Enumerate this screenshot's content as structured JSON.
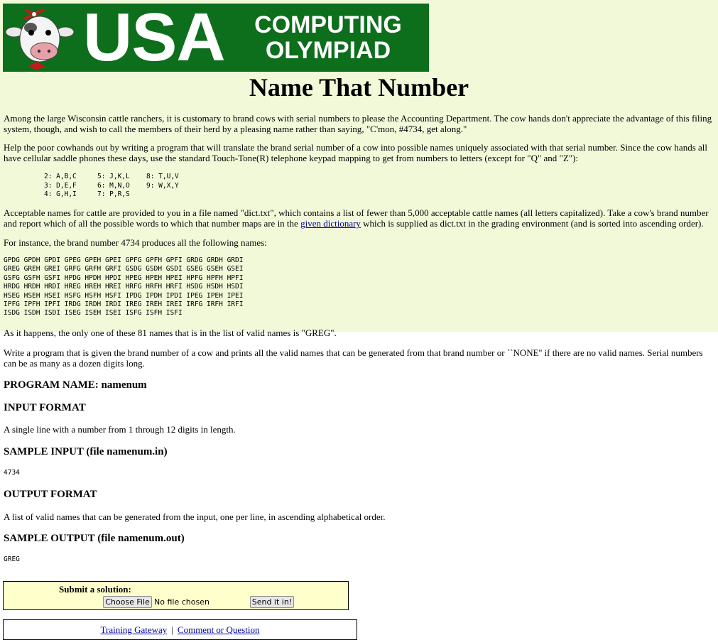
{
  "banner": {
    "line1": "USA",
    "line2": "COMPUTING",
    "line3": "OLYMPIAD"
  },
  "title": "Name That Number",
  "para1": "Among the large Wisconsin cattle ranchers, it is customary to brand cows with serial numbers to please the Accounting Department. The cow hands don't appreciate the advantage of this filing system, though, and wish to call the members of their herd by a pleasing name rather than saying, \"C'mon, #4734, get along.\"",
  "para2": "Help the poor cowhands out by writing a program that will translate the brand serial number of a cow into possible names uniquely associated with that serial number. Since the cow hands all have cellular saddle phones these days, use the standard Touch-Tone(R) telephone keypad mapping to get from numbers to letters (except for \"Q\" and \"Z\"):",
  "keypad": [
    [
      "2: A,B,C",
      "5: J,K,L",
      "8: T,U,V"
    ],
    [
      "3: D,E,F",
      "6: M,N,O",
      "9: W,X,Y"
    ],
    [
      "4: G,H,I",
      "7: P,R,S",
      ""
    ]
  ],
  "para3_before": "Acceptable names for cattle are provided to you in a file named \"dict.txt\", which contains a list of fewer than 5,000 acceptable cattle names (all letters capitalized). Take a cow's brand number and report which of all the possible words to which that number maps are in the ",
  "para3_link": "given dictionary",
  "para3_after": " which is supplied as dict.txt in the grading environment (and is sorted into ascending order).",
  "para4": "For instance, the brand number 4734 produces all the following names:",
  "names_grid": [
    "GPDG GPDH GPDI GPEG GPEH GPEI GPFG GPFH GPFI GRDG GRDH GRDI",
    "GREG GREH GREI GRFG GRFH GRFI GSDG GSDH GSDI GSEG GSEH GSEI",
    "GSFG GSFH GSFI HPDG HPDH HPDI HPEG HPEH HPEI HPFG HPFH HPFI",
    "HRDG HRDH HRDI HREG HREH HREI HRFG HRFH HRFI HSDG HSDH HSDI",
    "HSEG HSEH HSEI HSFG HSFH HSFI IPDG IPDH IPDI IPEG IPEH IPEI",
    "IPFG IPFH IPFI IRDG IRDH IRDI IREG IREH IREI IRFG IRFH IRFI",
    "ISDG ISDH ISDI ISEG ISEH ISEI ISFG ISFH ISFI"
  ],
  "para5": "As it happens, the only one of these 81 names that is in the list of valid names is \"GREG\".",
  "para6": "Write a program that is given the brand number of a cow and prints all the valid names that can be generated from that brand number or ``NONE'' if there are no valid names. Serial numbers can be as many as a dozen digits long.",
  "program_name": "PROGRAM NAME: namenum",
  "input_format_heading": "INPUT FORMAT",
  "input_format_text": "A single line with a number from 1 through 12 digits in length.",
  "sample_input_heading": "SAMPLE INPUT (file namenum.in)",
  "sample_input": "4734",
  "output_format_heading": "OUTPUT FORMAT",
  "output_format_text": "A list of valid names that can be generated from the input, one per line, in ascending alphabetical order.",
  "sample_output_heading": "SAMPLE OUTPUT (file namenum.out)",
  "sample_output": "GREG",
  "submit": {
    "title": "Submit a solution:",
    "choose_file_label": "Choose File",
    "file_status": "No file chosen",
    "send_label": "Send it in!"
  },
  "footer": {
    "link1": "Training Gateway",
    "separator": "|",
    "link2": "Comment or Question"
  }
}
